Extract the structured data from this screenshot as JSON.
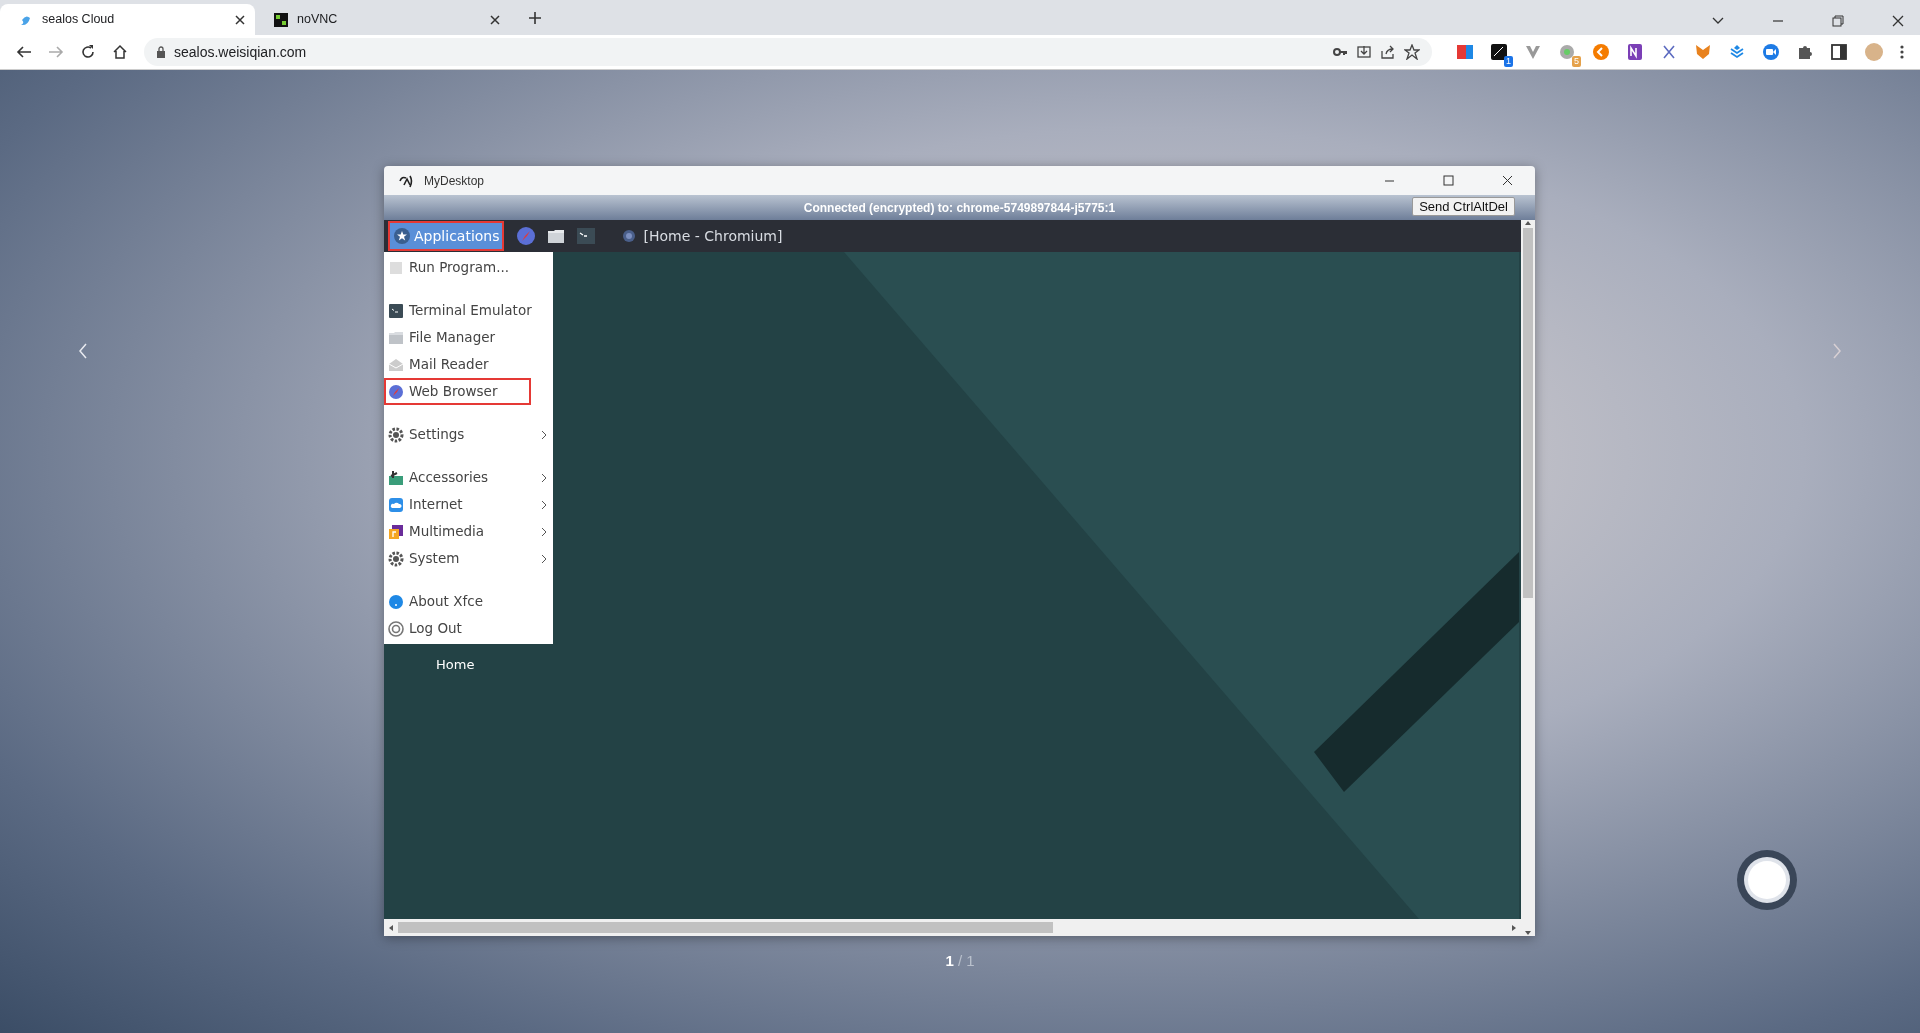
{
  "browser": {
    "tabs": [
      {
        "title": "sealos Cloud",
        "selected": true,
        "kind": "sealos"
      },
      {
        "title": "noVNC",
        "selected": false,
        "kind": "novnc"
      }
    ],
    "url": "sealos.weisiqian.com",
    "extensions": [
      {
        "kind": "fe"
      },
      {
        "kind": "en",
        "badge": "1"
      },
      {
        "kind": "v"
      },
      {
        "kind": "dot",
        "badge": "5"
      },
      {
        "kind": "orange"
      },
      {
        "kind": "note"
      },
      {
        "kind": "x"
      },
      {
        "kind": "fox"
      },
      {
        "kind": "layers"
      },
      {
        "kind": "camera"
      },
      {
        "kind": "puzzle"
      },
      {
        "kind": "panel"
      },
      {
        "kind": "avatar"
      }
    ]
  },
  "window": {
    "title": "MyDesktop",
    "status": "Connected (encrypted) to: chrome-5749897844-j5775:1",
    "send_button": "Send CtrlAltDel",
    "panel": {
      "applications": {
        "label": "Applications",
        "outlined": true
      },
      "launchers": [
        {
          "kind": "browser"
        },
        {
          "kind": "folder"
        },
        {
          "kind": "terminal"
        }
      ],
      "tasks": [
        {
          "label": "[Home - Chromium]"
        }
      ]
    },
    "menu": [
      {
        "kind": "item",
        "label": "Run Program...",
        "submenu": false,
        "outlined": false
      },
      {
        "kind": "separator"
      },
      {
        "kind": "item",
        "label": "Terminal Emulator",
        "submenu": false,
        "outlined": false
      },
      {
        "kind": "item",
        "label": "File Manager",
        "submenu": false,
        "outlined": false
      },
      {
        "kind": "item",
        "label": "Mail Reader",
        "submenu": false,
        "outlined": false
      },
      {
        "kind": "item",
        "label": "Web Browser",
        "submenu": false,
        "outlined": true
      },
      {
        "kind": "separator"
      },
      {
        "kind": "item",
        "label": "Settings",
        "submenu": true,
        "outlined": false
      },
      {
        "kind": "separator"
      },
      {
        "kind": "item",
        "label": "Accessories",
        "submenu": true,
        "outlined": false
      },
      {
        "kind": "item",
        "label": "Internet",
        "submenu": true,
        "outlined": false
      },
      {
        "kind": "item",
        "label": "Multimedia",
        "submenu": true,
        "outlined": false
      },
      {
        "kind": "item",
        "label": "System",
        "submenu": true,
        "outlined": false
      },
      {
        "kind": "separator"
      },
      {
        "kind": "item",
        "label": "About Xfce",
        "submenu": false,
        "outlined": false
      },
      {
        "kind": "item",
        "label": "Log Out",
        "submenu": false,
        "outlined": false
      }
    ],
    "desktop_icons": [
      {
        "label": "Home"
      }
    ]
  },
  "pager": {
    "current": "1",
    "rest": "/ 1"
  }
}
